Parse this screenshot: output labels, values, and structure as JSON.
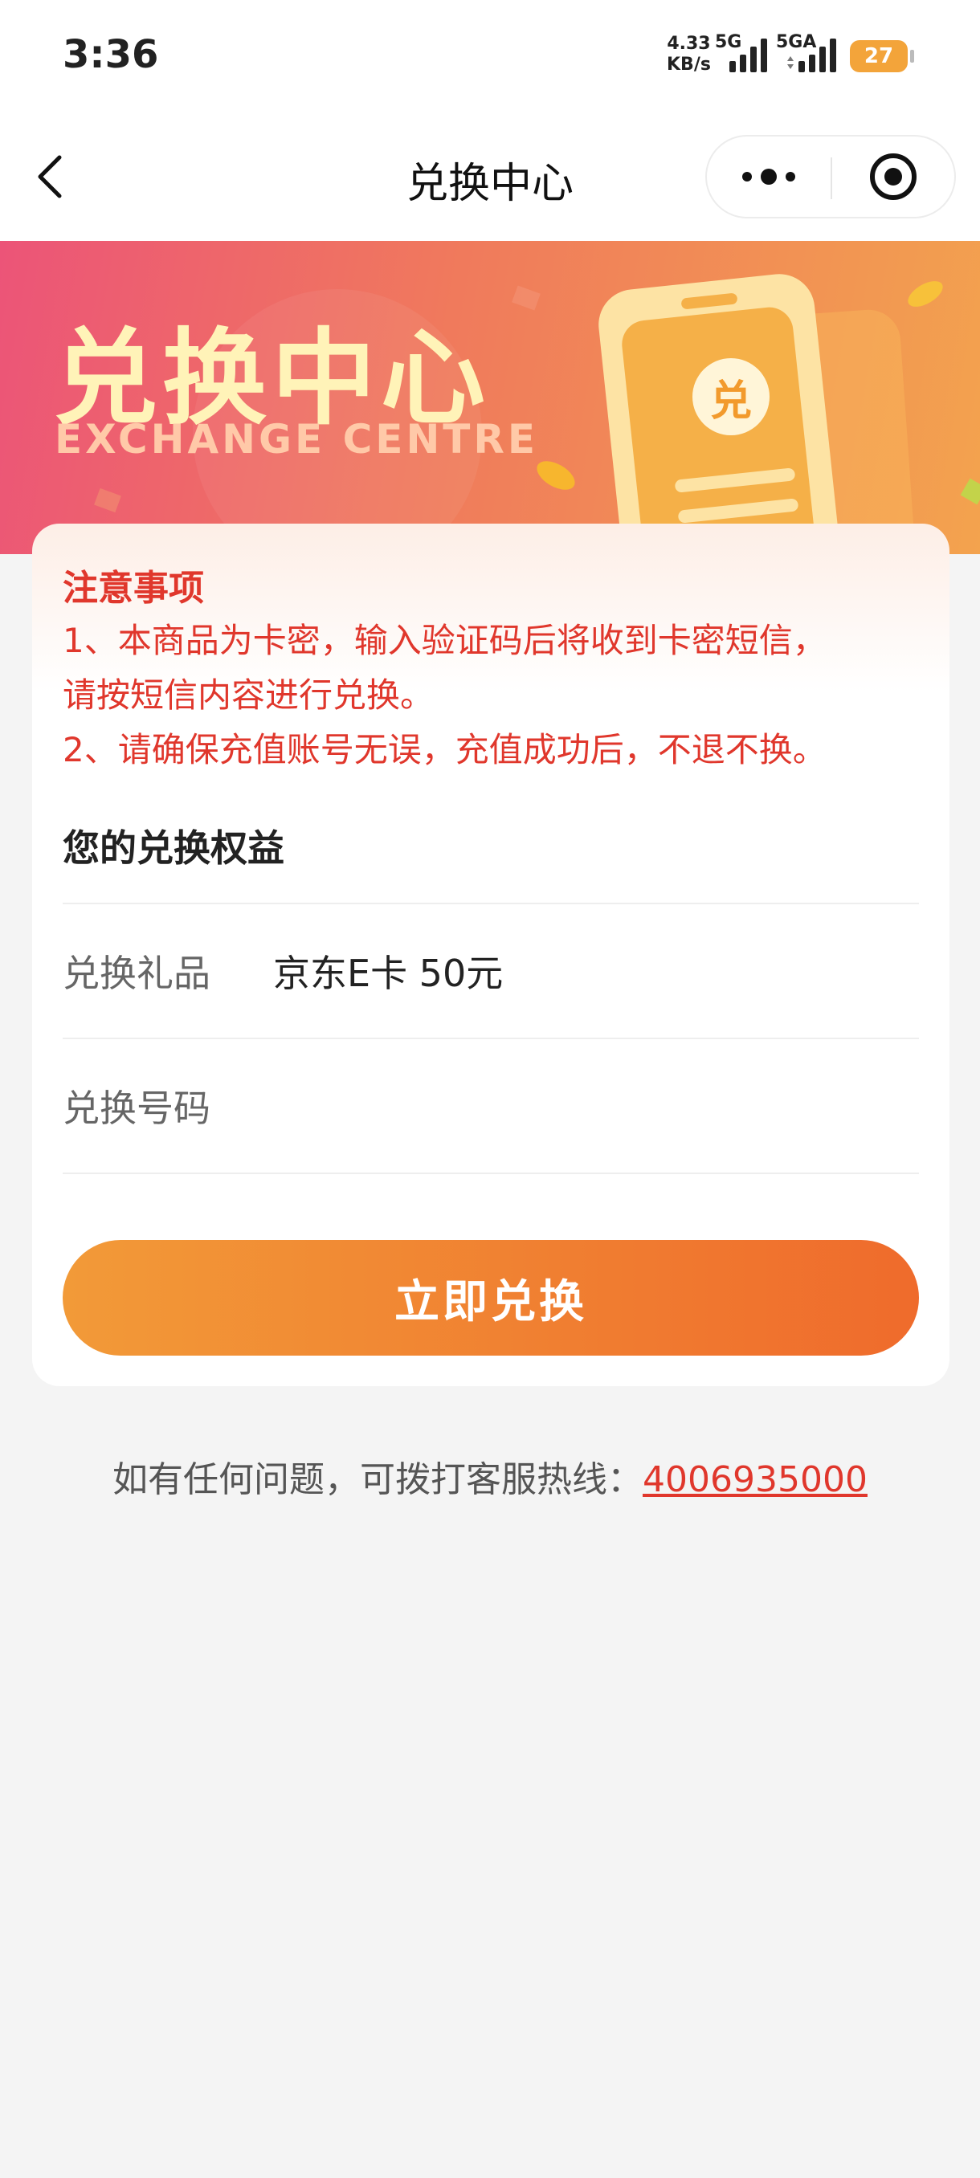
{
  "status_bar": {
    "time": "3:36",
    "net_speed_value": "4.33",
    "net_speed_unit": "KB/s",
    "signal1_label": "5G",
    "signal2_label": "5GA",
    "battery": "27",
    "battery_color": "#f3a43a"
  },
  "nav": {
    "title": "兑换中心"
  },
  "banner": {
    "title": "兑换中心",
    "subtitle": "EXCHANGE CENTRE",
    "badge_char": "兑"
  },
  "notice": {
    "title": "注意事项",
    "lines": [
      "1、本商品为卡密，输入验证码后将收到卡密短信，",
      "请按短信内容进行兑换。",
      "2、请确保充值账号无误，充值成功后，不退不换。"
    ]
  },
  "benefit": {
    "title": "您的兑换权益",
    "gift_label": "兑换礼品",
    "gift_value": "京东E卡 50元",
    "code_label": "兑换号码",
    "code_value": ""
  },
  "redeem_button": "立即兑换",
  "hotline": {
    "prefix": "如有任何问题，可拨打客服热线：",
    "number": "4006935000"
  },
  "colors": {
    "accent_red": "#e0372c",
    "button_orange": "#ef6b2c",
    "banner_pink": "#ec5478"
  }
}
